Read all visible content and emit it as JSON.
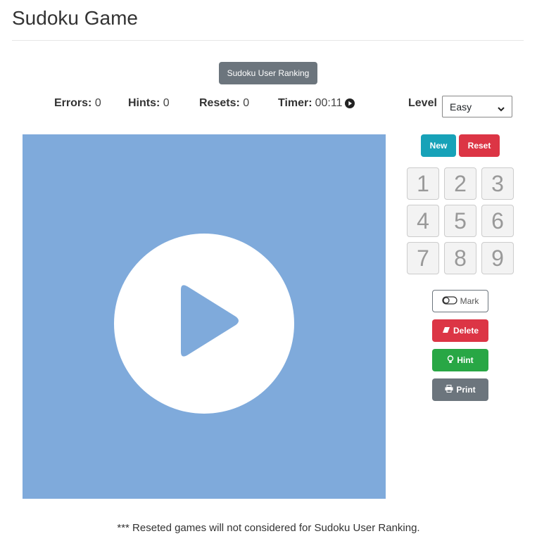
{
  "page": {
    "title": "Sudoku Game"
  },
  "ranking_button": {
    "label": "Sudoku User Ranking"
  },
  "stats": {
    "errors_label": "Errors:",
    "errors_value": "0",
    "hints_label": "Hints:",
    "hints_value": "0",
    "resets_label": "Resets:",
    "resets_value": "0",
    "timer_label": "Timer:",
    "timer_value": "00:11"
  },
  "level": {
    "label": "Level",
    "selected": "Easy"
  },
  "controls": {
    "new_label": "New",
    "reset_label": "Reset"
  },
  "keypad": [
    "1",
    "2",
    "3",
    "4",
    "5",
    "6",
    "7",
    "8",
    "9"
  ],
  "tools": {
    "mark_label": "Mark",
    "delete_label": "Delete",
    "hint_label": "Hint",
    "print_label": "Print"
  },
  "footer": {
    "note": "*** Reseted games will not considered for Sudoku User Ranking."
  },
  "colors": {
    "board": "#7faadb",
    "new": "#17a2b8",
    "reset": "#dc3545",
    "delete": "#dc3545",
    "hint": "#28a745",
    "print": "#6c757d",
    "ranking": "#6c757d"
  },
  "icons": {
    "timer": "play-circle-icon",
    "board_overlay": "play-icon",
    "mark": "toggle-icon",
    "delete": "eraser-icon",
    "hint": "lightbulb-icon",
    "print": "printer-icon"
  }
}
